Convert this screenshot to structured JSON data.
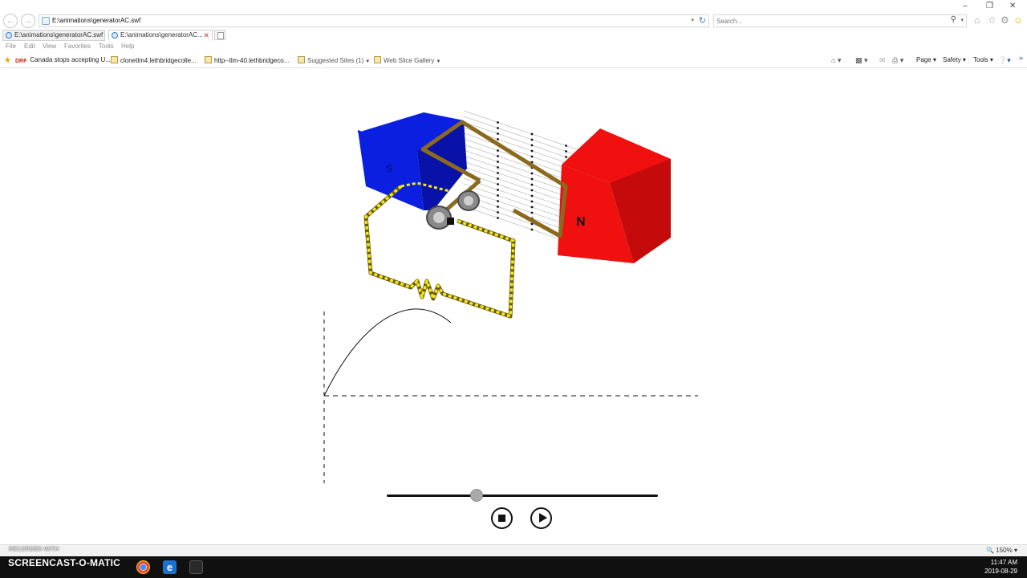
{
  "browser": {
    "address": "E:\\animations\\generatorAC.swf",
    "search_placeholder": "Search...",
    "tabs": [
      {
        "label": "E:\\animations\\generatorAC.swf"
      },
      {
        "label": "E:\\animations\\generatorAC..."
      }
    ],
    "menu": [
      "File",
      "Edit",
      "View",
      "Favorites",
      "Tools",
      "Help"
    ],
    "favorites": [
      {
        "label": "Canada stops accepting U...",
        "prefix": "DRF"
      },
      {
        "label": "clonetlm4.lethbridgecolle..."
      },
      {
        "label": "http--tlm-40.lethbridgeco..."
      },
      {
        "label": "Suggested Sites (1)"
      },
      {
        "label": "Web Slice Gallery"
      }
    ],
    "command_bar": [
      "Page",
      "Safety",
      "Tools"
    ],
    "zoom": "150%"
  },
  "generator": {
    "south_label": "S",
    "north_label": "N",
    "south_color": "#0a1fe0",
    "north_color": "#f01010",
    "coil_color": "#8b6a1e",
    "circuit_color": "#f2e81a"
  },
  "player": {
    "progress": 0.33
  },
  "recorder": {
    "recorded_with": "RECORDED WITH",
    "brand": "SCREENCAST-O-MATIC"
  },
  "taskbar": {
    "time": "11:47 AM",
    "date": "2019-08-29"
  }
}
